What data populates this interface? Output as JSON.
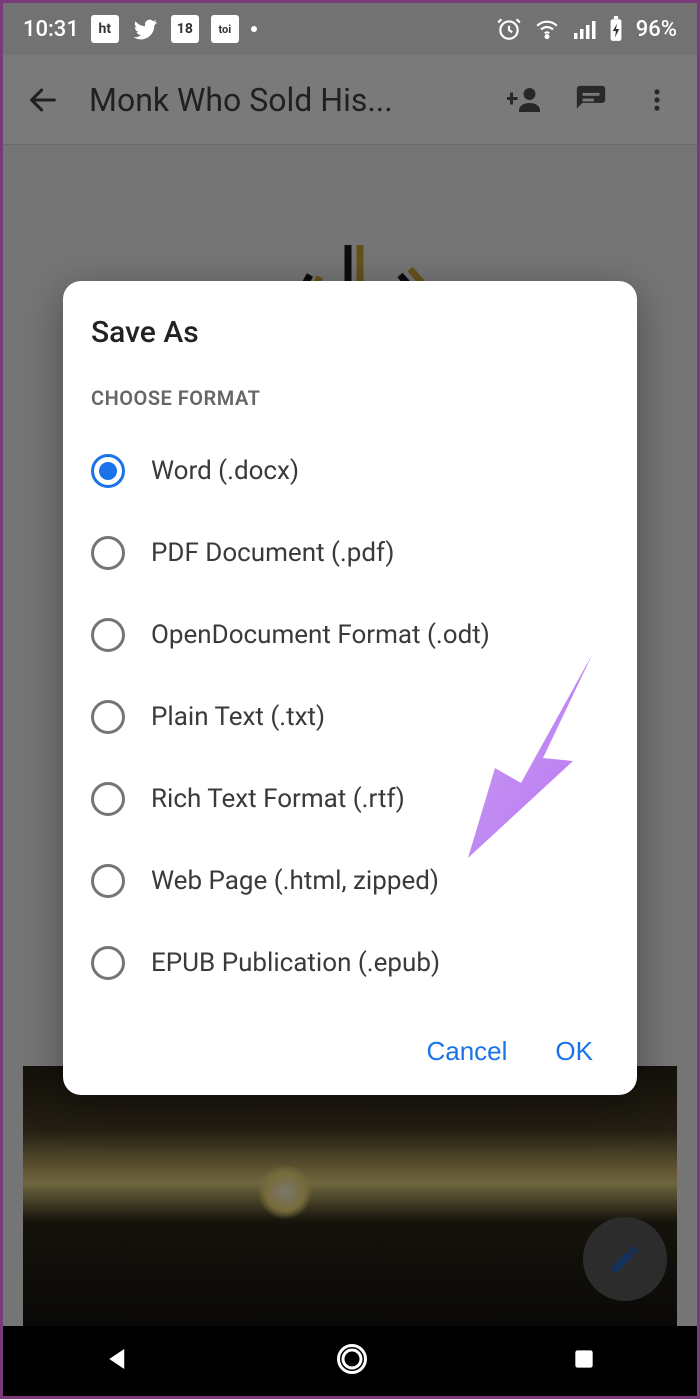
{
  "statusbar": {
    "time": "10:31",
    "badges": [
      "ht",
      "",
      "18",
      "toi"
    ],
    "battery_pct": "96%"
  },
  "header": {
    "title": "Monk Who Sold His..."
  },
  "dialog": {
    "title": "Save As",
    "subtitle": "CHOOSE FORMAT",
    "options": [
      {
        "label": "Word (.docx)",
        "selected": true
      },
      {
        "label": "PDF Document (.pdf)",
        "selected": false
      },
      {
        "label": "OpenDocument Format (.odt)",
        "selected": false
      },
      {
        "label": "Plain Text (.txt)",
        "selected": false
      },
      {
        "label": "Rich Text Format (.rtf)",
        "selected": false
      },
      {
        "label": "Web Page (.html, zipped)",
        "selected": false
      },
      {
        "label": "EPUB Publication (.epub)",
        "selected": false
      }
    ],
    "cancel": "Cancel",
    "ok": "OK"
  },
  "colors": {
    "accent": "#1a73e8",
    "arrow": "#c084fc"
  }
}
